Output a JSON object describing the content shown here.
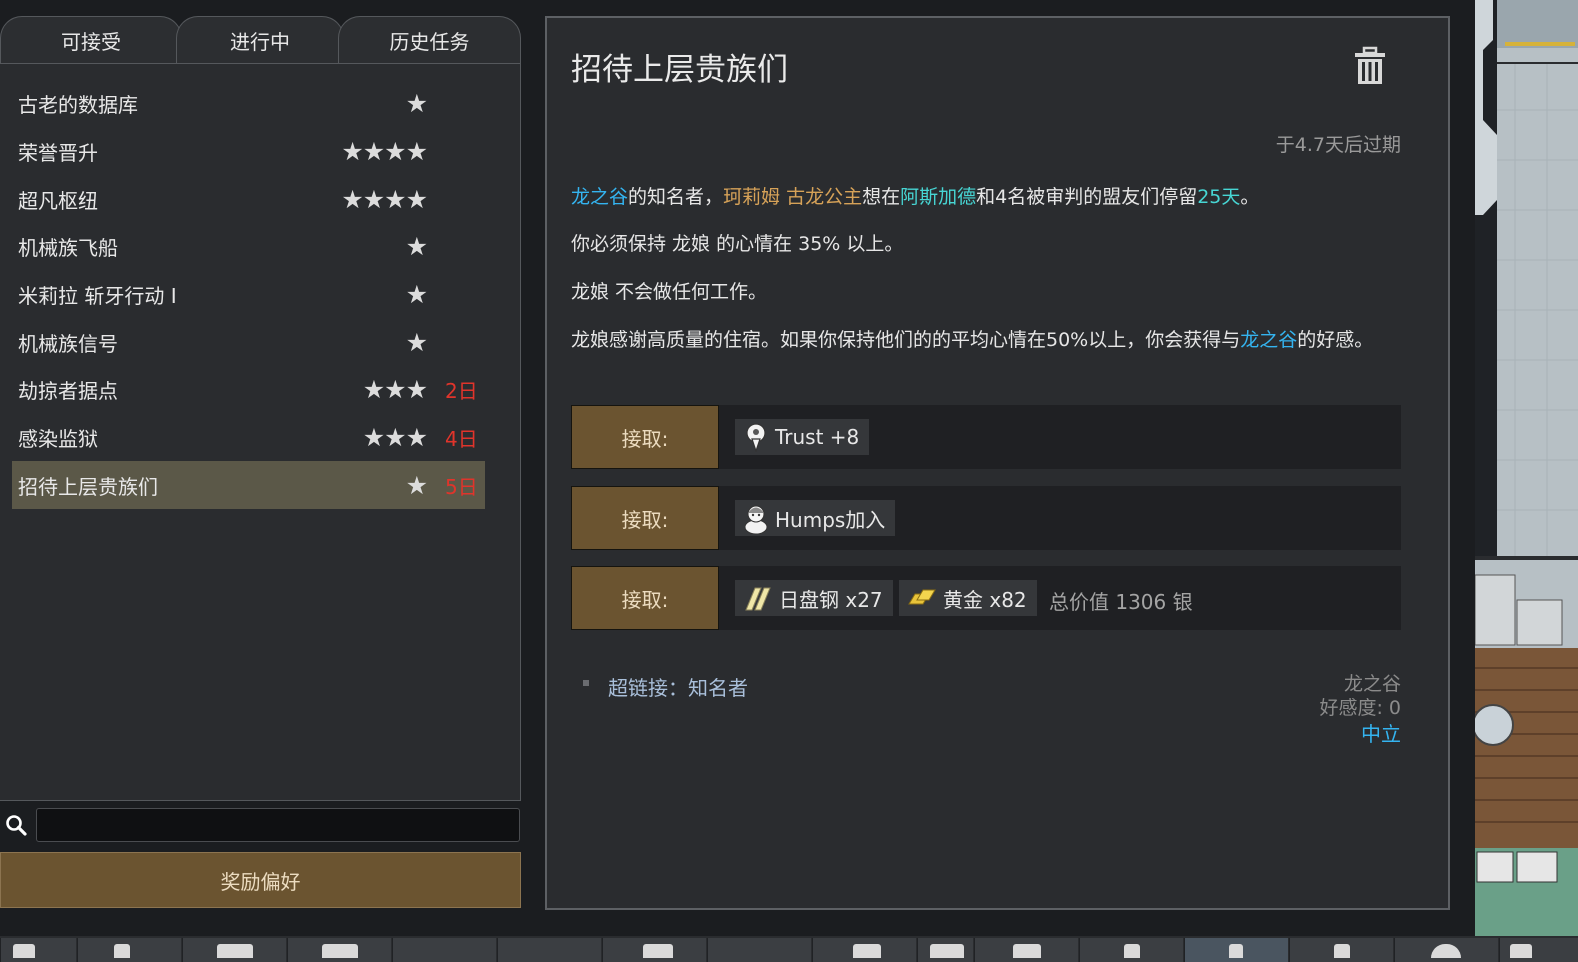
{
  "tabs": [
    {
      "label": "可接受"
    },
    {
      "label": "进行中"
    },
    {
      "label": "历史任务"
    }
  ],
  "quests": [
    {
      "name": "古老的数据库",
      "stars": "★",
      "days": ""
    },
    {
      "name": "荣誉晋升",
      "stars": "★★★★",
      "days": ""
    },
    {
      "name": "超凡枢纽",
      "stars": "★★★★",
      "days": ""
    },
    {
      "name": "机械族飞船",
      "stars": "★",
      "days": ""
    },
    {
      "name": "米莉拉 斩牙行动 I",
      "stars": "★",
      "days": ""
    },
    {
      "name": "机械族信号",
      "stars": "★",
      "days": ""
    },
    {
      "name": "劫掠者据点",
      "stars": "★★★",
      "days": "2日"
    },
    {
      "name": "感染监狱",
      "stars": "★★★",
      "days": "4日"
    },
    {
      "name": "招待上层贵族们",
      "stars": "★",
      "days": "5日",
      "selected": true
    }
  ],
  "search": {
    "value": "",
    "placeholder": ""
  },
  "reward_pref_label": "奖励偏好",
  "detail": {
    "title": "招待上层贵族们",
    "expire": "于4.7天后过期",
    "desc": {
      "p1_faction": "龙之谷",
      "p1_a": "的知名者，",
      "p1_person": "珂莉姆 古龙公主",
      "p1_b": "想在",
      "p1_place": "阿斯加德",
      "p1_c": "和4名被审判的盟友们停留",
      "p1_days": "25天",
      "p1_d": "。",
      "p2": "你必须保持 龙娘 的心情在 35% 以上。",
      "p3": "龙娘 不会做任何工作。",
      "p4_a": "龙娘感谢高质量的住宿。如果你保持他们的的平均心情在50%以上，你会获得与",
      "p4_faction": "龙之谷",
      "p4_b": "的好感。"
    },
    "rewards": [
      {
        "accept": "接取:",
        "items": [
          {
            "icon": "trust-icon",
            "label": "Trust +8"
          }
        ]
      },
      {
        "accept": "接取:",
        "items": [
          {
            "icon": "pawn-portrait-icon",
            "label": "Humps加入"
          }
        ]
      },
      {
        "accept": "接取:",
        "items": [
          {
            "icon": "plasteel-icon",
            "label": "日盘钢 x27"
          },
          {
            "icon": "gold-icon",
            "label": "黄金 x82"
          }
        ],
        "total": "总价值 1306 银"
      }
    ],
    "hyperlink": "超链接：知名者",
    "faction": {
      "name": "龙之谷",
      "goodwill": "好感度: 0",
      "status": "中立"
    }
  },
  "colors": {
    "accent_blue": "#34b4f0",
    "accent_orange": "#d6a258",
    "accent_cyan": "#47d6d4",
    "days_red": "#e0342b",
    "button_brown": "#6b5430"
  }
}
